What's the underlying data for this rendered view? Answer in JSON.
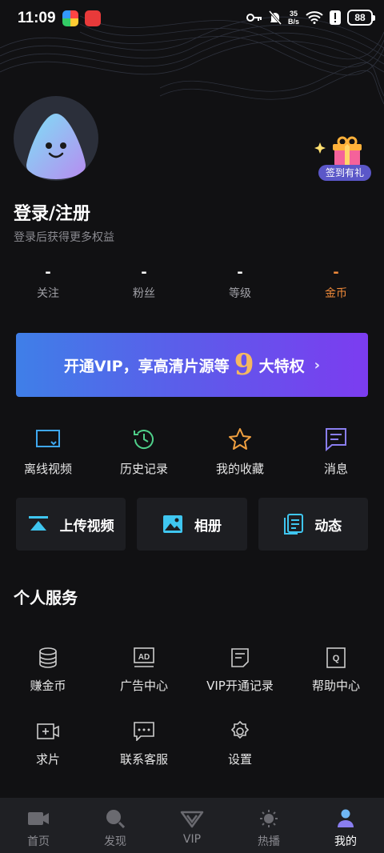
{
  "status": {
    "time": "11:09",
    "net_speed_top": "35",
    "net_speed_bottom": "B/s",
    "battery": "88"
  },
  "profile": {
    "title": "登录/注册",
    "subtitle": "登录后获得更多权益",
    "signin_label": "签到有礼"
  },
  "stats": [
    {
      "value": "-",
      "label": "关注"
    },
    {
      "value": "-",
      "label": "粉丝"
    },
    {
      "value": "-",
      "label": "等级"
    },
    {
      "value": "-",
      "label": "金币"
    }
  ],
  "vip_banner": {
    "text_before": "开通VIP，享高清片源等",
    "number": "9",
    "text_after": "大特权"
  },
  "quick_actions": [
    {
      "label": "离线视频",
      "icon": "offline-video-icon"
    },
    {
      "label": "历史记录",
      "icon": "history-icon"
    },
    {
      "label": "我的收藏",
      "icon": "star-icon"
    },
    {
      "label": "消息",
      "icon": "message-icon"
    }
  ],
  "cards": [
    {
      "label": "上传视频",
      "icon": "upload-icon"
    },
    {
      "label": "相册",
      "icon": "album-icon"
    },
    {
      "label": "动态",
      "icon": "feed-icon"
    }
  ],
  "services": {
    "title": "个人服务",
    "items": [
      {
        "label": "赚金币",
        "icon": "coins-icon"
      },
      {
        "label": "广告中心",
        "icon": "ad-icon"
      },
      {
        "label": "VIP开通记录",
        "icon": "record-icon"
      },
      {
        "label": "帮助中心",
        "icon": "help-icon"
      },
      {
        "label": "求片",
        "icon": "request-video-icon"
      },
      {
        "label": "联系客服",
        "icon": "customer-service-icon"
      },
      {
        "label": "设置",
        "icon": "settings-icon"
      }
    ]
  },
  "tabs": [
    {
      "label": "首页",
      "icon": "home-camera-icon",
      "active": false
    },
    {
      "label": "发现",
      "icon": "discover-icon",
      "active": false
    },
    {
      "label": "VIP",
      "icon": "vip-icon",
      "active": false
    },
    {
      "label": "热播",
      "icon": "hot-icon",
      "active": false
    },
    {
      "label": "我的",
      "icon": "user-icon",
      "active": true
    }
  ],
  "colors": {
    "accent": "#5d5bea",
    "gold": "#f08a3a",
    "cyan": "#3fc6f0"
  }
}
